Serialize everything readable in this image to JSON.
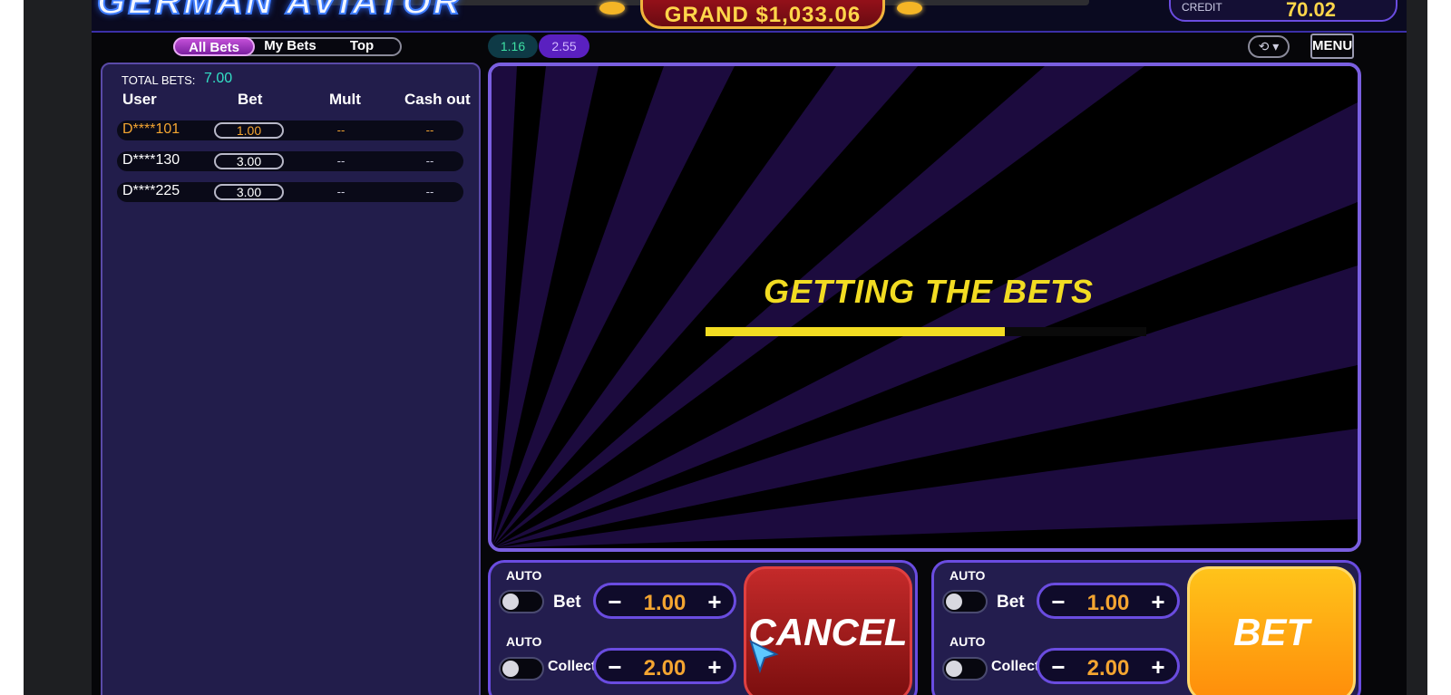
{
  "header": {
    "logo": "GERMAN AVIATOR",
    "jackpot": "GRAND $1,033.06",
    "credit_label": "CREDIT",
    "credit_value": "70.02"
  },
  "tabs": [
    {
      "label": "All Bets",
      "active": true
    },
    {
      "label": "My Bets",
      "active": false
    },
    {
      "label": "Top",
      "active": false
    }
  ],
  "history": [
    "1.16",
    "2.55"
  ],
  "menu_label": "MENU",
  "bets_panel": {
    "total_label": "TOTAL BETS:",
    "total_value": "7.00",
    "columns": [
      "User",
      "Bet",
      "Mult",
      "Cash out"
    ],
    "rows": [
      {
        "user": "D****101",
        "bet": "1.00",
        "mult": "--",
        "cash_out": "--",
        "mine": true
      },
      {
        "user": "D****130",
        "bet": "3.00",
        "mult": "--",
        "cash_out": "--",
        "mine": false
      },
      {
        "user": "D****225",
        "bet": "3.00",
        "mult": "--",
        "cash_out": "--",
        "mine": false
      }
    ]
  },
  "stage": {
    "status_text": "GETTING THE BETS",
    "progress": 0.68
  },
  "panels": [
    {
      "auto_label_1": "AUTO",
      "bet_label": "Bet",
      "bet_value": "1.00",
      "auto_label_2": "AUTO",
      "collect_label": "Collect",
      "collect_value": "2.00",
      "action_label": "CANCEL"
    },
    {
      "auto_label_1": "AUTO",
      "bet_label": "Bet",
      "bet_value": "1.00",
      "auto_label_2": "AUTO",
      "collect_label": "Collect",
      "collect_value": "2.00",
      "action_label": "BET"
    }
  ],
  "colors": {
    "accent": "#6a4ce0",
    "gold": "#f4a531",
    "cancel": "#c42a2a",
    "bet": "#ffb215"
  }
}
